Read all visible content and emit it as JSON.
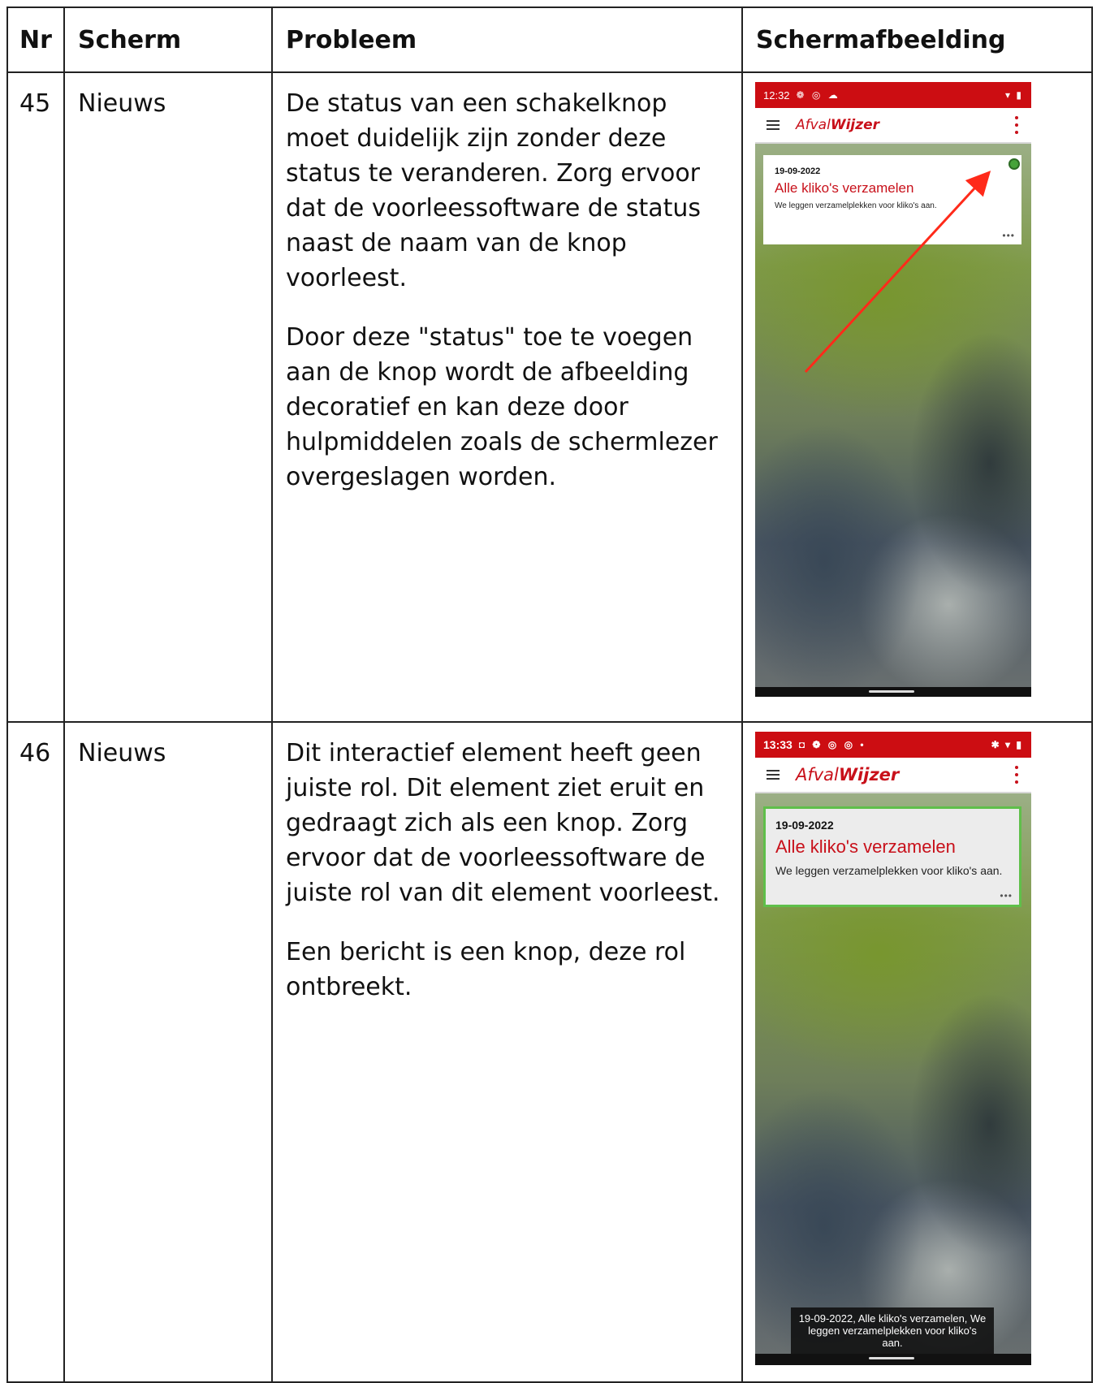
{
  "table": {
    "headers": {
      "nr": "Nr",
      "scherm": "Scherm",
      "probleem": "Probleem",
      "schermafbeelding": "Schermafbeelding"
    },
    "rows": [
      {
        "nr": "45",
        "scherm": "Nieuws",
        "probleem": [
          "De status van een schakelknop moet duidelijk zijn zonder deze status te veranderen. Zorg ervoor dat de voorleessoftware de status naast de naam van de knop voorleest.",
          "Door deze \"status\" toe te voegen aan de knop wordt de afbeelding decoratief en kan deze door hulpmiddelen zoals de schermlezer overgeslagen worden."
        ],
        "screenshot": {
          "time": "12:32",
          "status_icons": "❁ ◎ ☁",
          "status_right": "▾ ▮",
          "logo_light": "Afval",
          "logo_bold": "Wijzer",
          "card": {
            "date": "19-09-2022",
            "title": "Alle kliko's verzamelen",
            "text": "We leggen verzamelplekken voor kliko's aan.",
            "more": "•••"
          },
          "toggle_color": "#46a33a",
          "arrow_color": "#ff2a1a"
        }
      },
      {
        "nr": "46",
        "scherm": "Nieuws",
        "probleem": [
          "Dit interactief element heeft geen juiste rol. Dit element ziet eruit en gedraagt zich als een knop. Zorg ervoor dat de voorleessoftware de juiste rol van dit element voorleest.",
          "Een bericht is een knop, deze rol ontbreekt."
        ],
        "screenshot": {
          "time": "13:33",
          "status_icons": "◘ ❁ ◎ ◎ •",
          "status_right": "✱ ▾ ▮",
          "logo_light": "Afval",
          "logo_bold": "Wijzer",
          "card": {
            "date": "19-09-2022",
            "title": "Alle kliko's verzamelen",
            "text": "We leggen verzamelplekken voor kliko's aan.",
            "more": "•••"
          },
          "focus_color": "#5fbf4a",
          "tts_caption": "19-09-2022, Alle kliko's verzamelen, We leggen verzamelplekken voor kliko's aan."
        }
      }
    ]
  }
}
